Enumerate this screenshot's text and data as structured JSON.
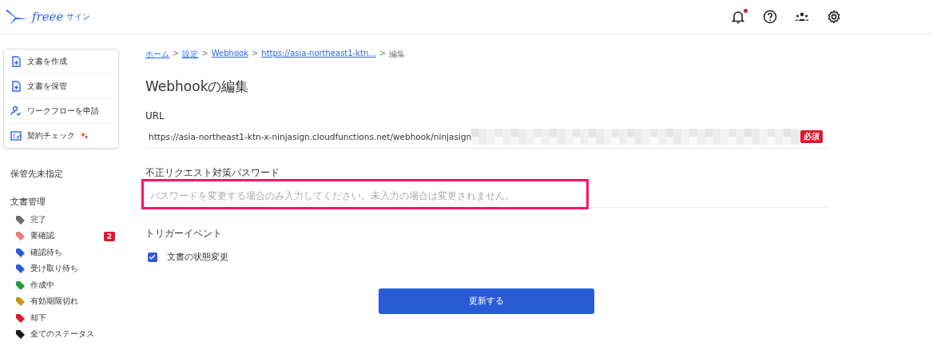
{
  "header": {
    "logo": "freee",
    "logo_suffix": "サイン",
    "notification_unread": true
  },
  "sidebar": {
    "actions": [
      {
        "label": "文書を作成",
        "kind": "create"
      },
      {
        "label": "文書を保管",
        "kind": "store"
      },
      {
        "label": "ワークフローを申請",
        "kind": "workflow"
      },
      {
        "label": "契約チェック",
        "kind": "check",
        "sparkle": true
      }
    ],
    "storage": "保管先未指定",
    "section": "文書管理",
    "statuses": [
      {
        "label": "完了",
        "color": "#6e6e6e"
      },
      {
        "label": "要確認",
        "color": "#f08080",
        "count": "2"
      },
      {
        "label": "確認待ち",
        "color": "#2a5bd7"
      },
      {
        "label": "受け取り待ち",
        "color": "#2a5bd7"
      },
      {
        "label": "作成中",
        "color": "#1e9a3c"
      },
      {
        "label": "有効期限切れ",
        "color": "#c8961e"
      },
      {
        "label": "却下",
        "color": "#e0182d"
      },
      {
        "label": "全てのステータス",
        "color": "#1a1a1a"
      }
    ]
  },
  "breadcrumb": [
    {
      "label": "ホーム",
      "link": true
    },
    {
      "separator": ">",
      "label": "設定",
      "link": true
    },
    {
      "separator": ">",
      "label": "Webhook",
      "link": true
    },
    {
      "separator": ">",
      "label": "https://asia-northeast1-ktn...",
      "link": true
    },
    {
      "separator": ">",
      "label": "編集",
      "link": false
    }
  ],
  "title": "Webhookの編集",
  "url_field": {
    "label": "URL",
    "value": "https://asia-northeast1-ktn-x-ninjasign.cloudfunctions.net/webhook/ninjasign",
    "required": "必須"
  },
  "password_field": {
    "label": "不正リクエスト対策パスワード",
    "placeholder": "パスワードを変更する場合のみ入力してください。未入力の場合は変更されません。",
    "highlighted": true
  },
  "trigger": {
    "label": "トリガーイベント",
    "options": [
      {
        "label": "文書の状態変更",
        "checked": true
      }
    ]
  },
  "submit": "更新する"
}
